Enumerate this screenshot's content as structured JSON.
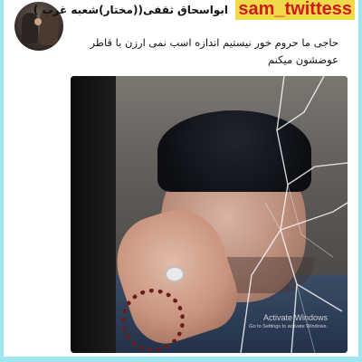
{
  "tweet": {
    "display_name": "ابواسحاق ثقفی((مختار)شعبه غرب )",
    "text": "حاجی ما حروم خور نیستیم اندازه اسب نمی ارزن با قاطر عوضشون میکنم"
  },
  "overlay": {
    "handle": "sam_twittess",
    "handle_bg": "#f2d94a",
    "handle_color": "#d11a1a"
  },
  "media": {
    "watermark_title": "Activate Windows",
    "watermark_subtitle": "Go to Settings to activate Windows."
  },
  "colors": {
    "frame": "#9fe7ee",
    "text": "#111111"
  }
}
